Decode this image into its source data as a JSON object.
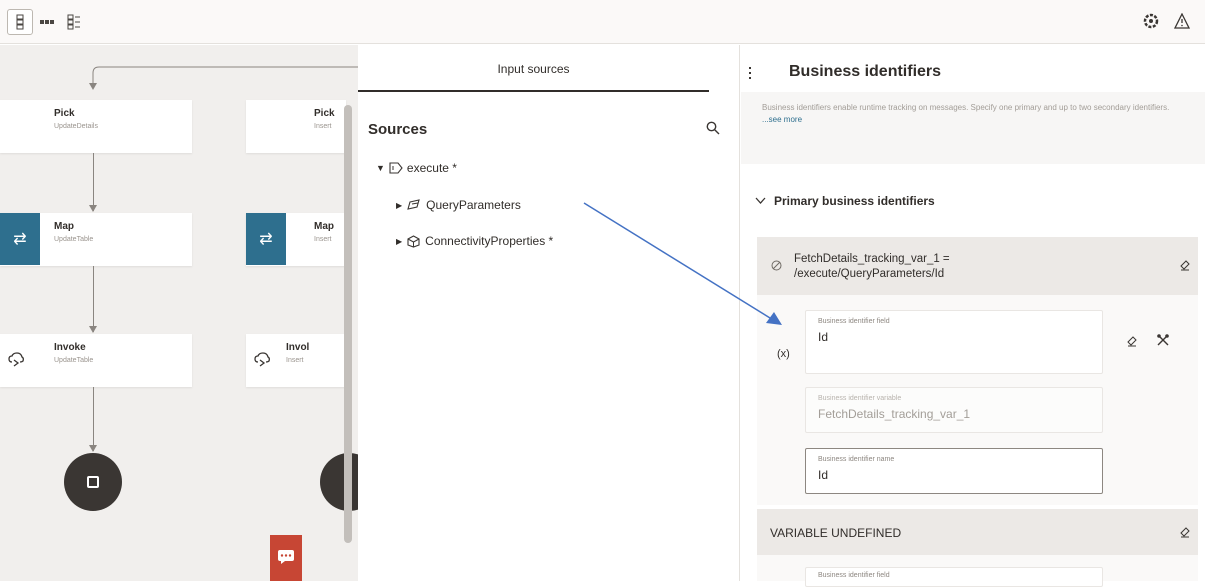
{
  "toolbar": {
    "icons": [
      "vertical-layout-icon",
      "horizontal-layout-icon",
      "tree-layout-icon"
    ],
    "right_icons": [
      "settings-icon",
      "warning-icon"
    ]
  },
  "canvas": {
    "nodes": [
      {
        "title": "Pick",
        "subtitle": "UpdateDetails"
      },
      {
        "title": "Pick",
        "subtitle": "Insert"
      },
      {
        "title": "Map",
        "subtitle": "UpdateTable"
      },
      {
        "title": "Map",
        "subtitle": "Insert"
      },
      {
        "title": "Invoke",
        "subtitle": "UpdateTable"
      },
      {
        "title": "Invol",
        "subtitle": "Insert"
      }
    ]
  },
  "input_panel": {
    "tab_label": "Input sources",
    "sources_title": "Sources",
    "tree": {
      "root": "execute *",
      "children": [
        "QueryParameters",
        "ConnectivityProperties *"
      ]
    }
  },
  "business_panel": {
    "title": "Business identifiers",
    "description": "Business identifiers enable runtime tracking on messages. Specify one primary and up to two secondary identifiers.",
    "see_more": "...see more",
    "section_title": "Primary business identifiers",
    "primary_expression_line1": "FetchDetails_tracking_var_1 =",
    "primary_expression_line2": "/execute/QueryParameters/Id",
    "variable_marker": "(x)",
    "fields": {
      "field_label": "Business identifier field",
      "field_value": "Id",
      "variable_label": "Business identifier variable",
      "variable_value": "FetchDetails_tracking_var_1",
      "name_label": "Business identifier name",
      "name_value": "Id"
    },
    "undefined_label": "VARIABLE UNDEFINED",
    "next_field_label": "Business identifier field"
  },
  "colors": {
    "accent": "#2e6f8e",
    "chat": "#c74634",
    "arrow": "#4472c4"
  }
}
